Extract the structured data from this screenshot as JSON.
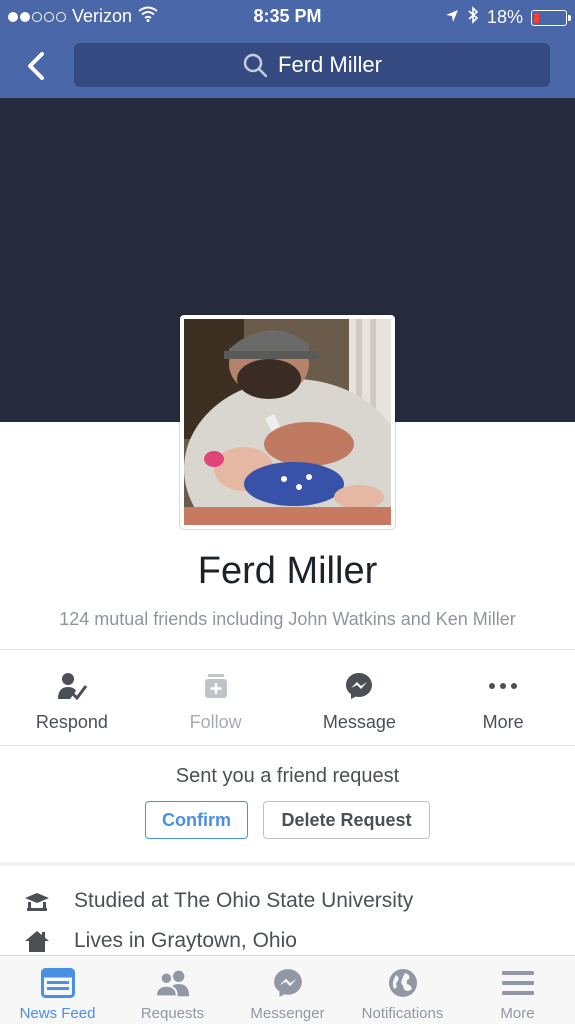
{
  "status_bar": {
    "carrier": "Verizon",
    "time": "8:35 PM",
    "battery_percent": "18%",
    "battery_level": 0.18
  },
  "nav": {
    "search_text": "Ferd Miller"
  },
  "profile": {
    "name": "Ferd Miller",
    "mutual_friends": "124 mutual friends including John Watkins and Ken Miller"
  },
  "actions": [
    {
      "label": "Respond",
      "icon": "respond-icon"
    },
    {
      "label": "Follow",
      "icon": "follow-icon"
    },
    {
      "label": "Message",
      "icon": "messenger-icon"
    },
    {
      "label": "More",
      "icon": "more-dots-icon"
    }
  ],
  "friend_request": {
    "text": "Sent you a friend request",
    "confirm_label": "Confirm",
    "delete_label": "Delete Request"
  },
  "intro": [
    {
      "text": "Studied at The Ohio State University",
      "icon": "education-icon"
    },
    {
      "text": "Lives in Graytown, Ohio",
      "icon": "home-icon"
    }
  ],
  "tabbar": [
    {
      "label": "News Feed",
      "icon": "news-feed-icon",
      "active": true
    },
    {
      "label": "Requests",
      "icon": "friend-requests-icon"
    },
    {
      "label": "Messenger",
      "icon": "messenger-icon"
    },
    {
      "label": "Notifications",
      "icon": "globe-icon"
    },
    {
      "label": "More",
      "icon": "menu-icon"
    }
  ],
  "colors": {
    "nav_blue": "#4a67a9",
    "cover": "#252b3c",
    "accent": "#4a90e2"
  }
}
